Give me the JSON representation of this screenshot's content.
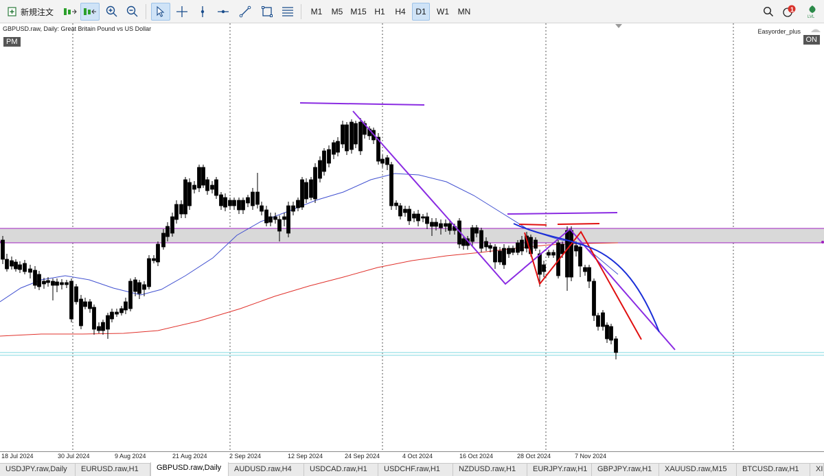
{
  "toolbar": {
    "new_order_label": "新規注文",
    "timeframes": [
      "M1",
      "M5",
      "M15",
      "H1",
      "H4",
      "D1",
      "W1",
      "MN"
    ],
    "active_timeframe": "D1",
    "notification_count": "1"
  },
  "chart": {
    "title": "GBPUSD.raw, Daily:  Great Britain Pound vs US Dollar",
    "left_badge": "PM",
    "right_badge": "ON",
    "expert_label": "Easyorder_plus",
    "x_dates": [
      "18 Jul 2024",
      "30 Jul 2024",
      "9 Aug 2024",
      "21 Aug 2024",
      "2 Sep 2024",
      "12 Sep 2024",
      "24 Sep 2024",
      "4 Oct 2024",
      "16 Oct 2024",
      "28 Oct 2024",
      "7 Nov 2024"
    ],
    "colors": {
      "candle": "#000000",
      "ma_short": "#3f4fd0",
      "ma_long": "#e0302a",
      "zone_fill": "#d9d9d9",
      "zone_border": "#a020c0",
      "drawing_purple": "#8a2be2",
      "drawing_red": "#e01010",
      "drawing_blue": "#1b2fd8",
      "support_line": "#7fd8e0"
    }
  },
  "tabs": [
    "USDJPY.raw,Daily",
    "EURUSD.raw,H1",
    "GBPUSD.raw,Daily",
    "AUDUSD.raw,H4",
    "USDCAD.raw,H1",
    "USDCHF.raw,H1",
    "NZDUSD.raw,H1",
    "EURJPY.raw,H1",
    "GBPJPY.raw,H1",
    "XAUUSD.raw,M15",
    "BTCUSD.raw,H1",
    "XI"
  ],
  "active_tab": "GBPUSD.raw,Daily"
}
